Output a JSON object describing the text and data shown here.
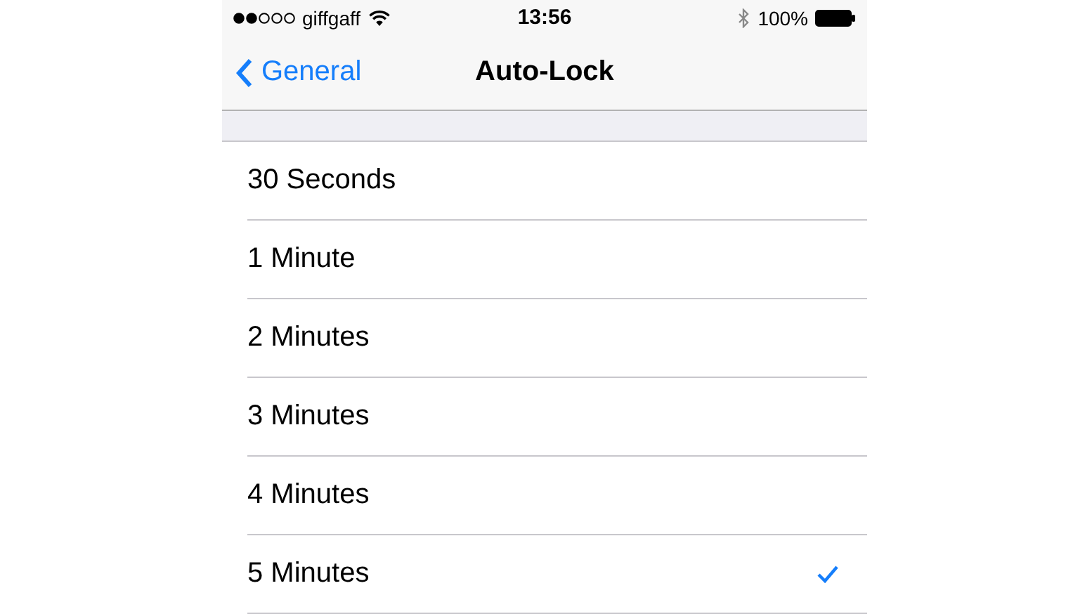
{
  "status_bar": {
    "carrier": "giffgaff",
    "time": "13:56",
    "battery": "100%"
  },
  "nav_bar": {
    "back": "General",
    "title": "Auto-Lock"
  },
  "options": [
    {
      "label": "30 Seconds",
      "selected": false
    },
    {
      "label": "1 Minute",
      "selected": false
    },
    {
      "label": "2 Minutes",
      "selected": false
    },
    {
      "label": "3 Minutes",
      "selected": false
    },
    {
      "label": "4 Minutes",
      "selected": false
    },
    {
      "label": "5 Minutes",
      "selected": true
    }
  ]
}
